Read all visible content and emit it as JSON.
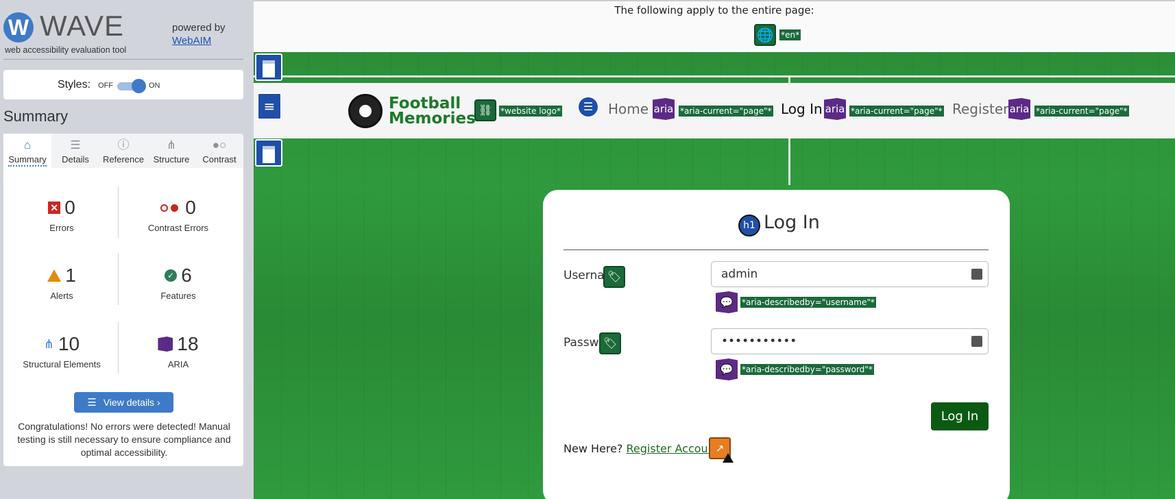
{
  "wave": {
    "logo_letter": "W",
    "title": "WAVE",
    "subtitle": "web accessibility evaluation tool",
    "powered_by": "powered by",
    "webaim_link": "WebAIM",
    "styles_label": "Styles:",
    "toggle_off": "OFF",
    "toggle_on": "ON",
    "summary_heading": "Summary",
    "tabs": [
      {
        "label": "Summary",
        "icon": "home-icon"
      },
      {
        "label": "Details",
        "icon": "list-icon"
      },
      {
        "label": "Reference",
        "icon": "info-icon"
      },
      {
        "label": "Structure",
        "icon": "hierarchy-icon"
      },
      {
        "label": "Contrast",
        "icon": "contrast-icon"
      }
    ],
    "stats": {
      "errors": {
        "count": "0",
        "label": "Errors"
      },
      "contrast": {
        "count": "0",
        "label": "Contrast Errors"
      },
      "alerts": {
        "count": "1",
        "label": "Alerts"
      },
      "features": {
        "count": "6",
        "label": "Features"
      },
      "structural": {
        "count": "10",
        "label": "Structural Elements"
      },
      "aria": {
        "count": "18",
        "label": "ARIA"
      }
    },
    "view_details": "View details ›",
    "congrats": "Congratulations! No errors were detected! Manual testing is still necessary to ensure compliance and optimal accessibility.",
    "colors": {
      "accent": "#3e7ac8",
      "error": "#c62828",
      "alert": "#e28a10",
      "feature": "#2e7d5b",
      "aria": "#5b2a86"
    }
  },
  "page": {
    "whole_page_note": "The following apply to the entire page:",
    "lang_tag": "*en*",
    "logo_line1": "Football",
    "logo_line2": "Memories",
    "logo_alt_tag": "*website logo*",
    "nav": [
      {
        "label": "Home",
        "aria_icon": "aria",
        "tag": "*aria-current=\"page\"*"
      },
      {
        "label": "Log In",
        "aria_icon": "aria",
        "tag": "*aria-current=\"page\"*"
      },
      {
        "label": "Register",
        "aria_icon": "aria",
        "tag": "*aria-current=\"page\"*"
      }
    ],
    "form": {
      "h1_icon": "h1",
      "title": "Log In",
      "username_label": "Username",
      "username_value": "admin",
      "username_desc_tag": "*aria-describedby=\"username\"*",
      "password_label": "Password",
      "password_value": "•••••••••••",
      "password_desc_tag": "*aria-describedby=\"password\"*",
      "submit": "Log In",
      "new_here": "New Here?",
      "register_link": "Register Account"
    }
  }
}
